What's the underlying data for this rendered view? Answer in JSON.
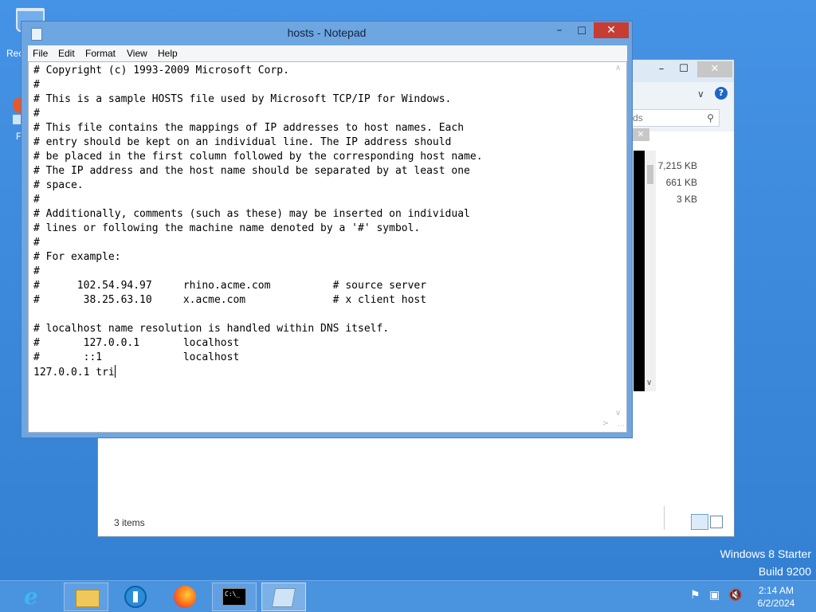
{
  "desktop": {
    "recycle_label": "Rec",
    "firefox_label": "F",
    "watermark_line1": "Windows 8 Starter",
    "watermark_line2": "Build 9200"
  },
  "explorer": {
    "min": "–",
    "max": "☐",
    "close": "✕",
    "search_partial": "ds",
    "sizes": [
      "7,215 KB",
      "661 KB",
      "3 KB"
    ],
    "status": "3 items",
    "tab_close": "✕"
  },
  "notepad": {
    "title": "hosts - Notepad",
    "min": "–",
    "max": "☐",
    "close": "✕",
    "menu": [
      "File",
      "Edit",
      "Format",
      "View",
      "Help"
    ],
    "lines": [
      "# Copyright (c) 1993-2009 Microsoft Corp.",
      "#",
      "# This is a sample HOSTS file used by Microsoft TCP/IP for Windows.",
      "#",
      "# This file contains the mappings of IP addresses to host names. Each",
      "# entry should be kept on an individual line. The IP address should",
      "# be placed in the first column followed by the corresponding host name.",
      "# The IP address and the host name should be separated by at least one",
      "# space.",
      "#",
      "# Additionally, comments (such as these) may be inserted on individual",
      "# lines or following the machine name denoted by a '#' symbol.",
      "#",
      "# For example:",
      "#",
      "#      102.54.94.97     rhino.acme.com          # source server",
      "#       38.25.63.10     x.acme.com              # x client host",
      "",
      "# localhost name resolution is handled within DNS itself.",
      "#       127.0.0.1       localhost",
      "#       ::1             localhost"
    ],
    "last_line": "127.0.0.1 tri"
  },
  "taskbar": {
    "ie_glyph": "e",
    "cmd_glyph": "C:\\_",
    "time": "2:14 AM",
    "date": "6/2/2024"
  },
  "icons": [
    "recycle-bin-icon",
    "firefox-desktop-icon",
    "notepad-icon",
    "search-icon",
    "help-icon",
    "ie-icon",
    "folder-icon",
    "network-globe-icon",
    "firefox-icon",
    "cmd-icon",
    "flag-icon",
    "network-icon",
    "volume-muted-icon"
  ]
}
